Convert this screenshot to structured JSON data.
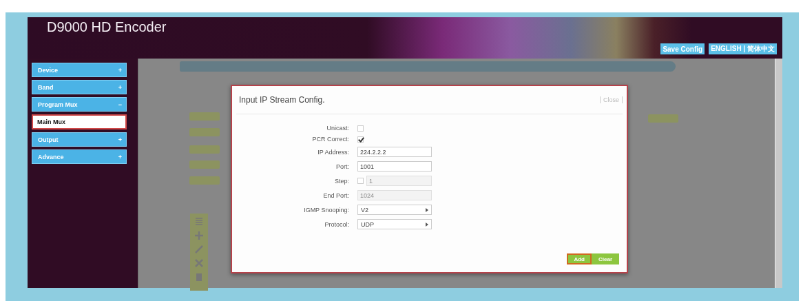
{
  "header": {
    "title": "D9000 HD Encoder",
    "save_button": "Save Config",
    "language": "ENGLISH | 简体中文"
  },
  "sidebar": {
    "items": [
      {
        "label": "Device",
        "sign": "+"
      },
      {
        "label": "Band",
        "sign": "+"
      },
      {
        "label": "Program Mux",
        "sign": "−",
        "children": [
          {
            "label": "Main Mux",
            "selected": true
          }
        ]
      },
      {
        "label": "Output",
        "sign": "+"
      },
      {
        "label": "Advance",
        "sign": "+"
      }
    ]
  },
  "dialog": {
    "title": "Input IP Stream Config.",
    "close": "Close",
    "fields": [
      {
        "kind": "checkbox",
        "label": "Unicast:",
        "checked": false
      },
      {
        "kind": "checkbox",
        "label": "PCR Correct:",
        "checked": true
      },
      {
        "kind": "text",
        "label": "IP Address:",
        "value": "224.2.2.2",
        "disabled": false
      },
      {
        "kind": "text",
        "label": "Port:",
        "value": "1001",
        "disabled": false
      },
      {
        "kind": "step",
        "label": "Step:",
        "checked": false,
        "placeholder": "1",
        "disabled": true
      },
      {
        "kind": "text",
        "label": "End Port:",
        "placeholder": "1024",
        "disabled": true
      },
      {
        "kind": "select",
        "label": "IGMP Snooping:",
        "value": "V2"
      },
      {
        "kind": "select",
        "label": "Protocol:",
        "value": "UDP"
      }
    ],
    "buttons": [
      {
        "label": "Add",
        "selected": true
      },
      {
        "label": "Clear",
        "selected": false
      }
    ]
  }
}
